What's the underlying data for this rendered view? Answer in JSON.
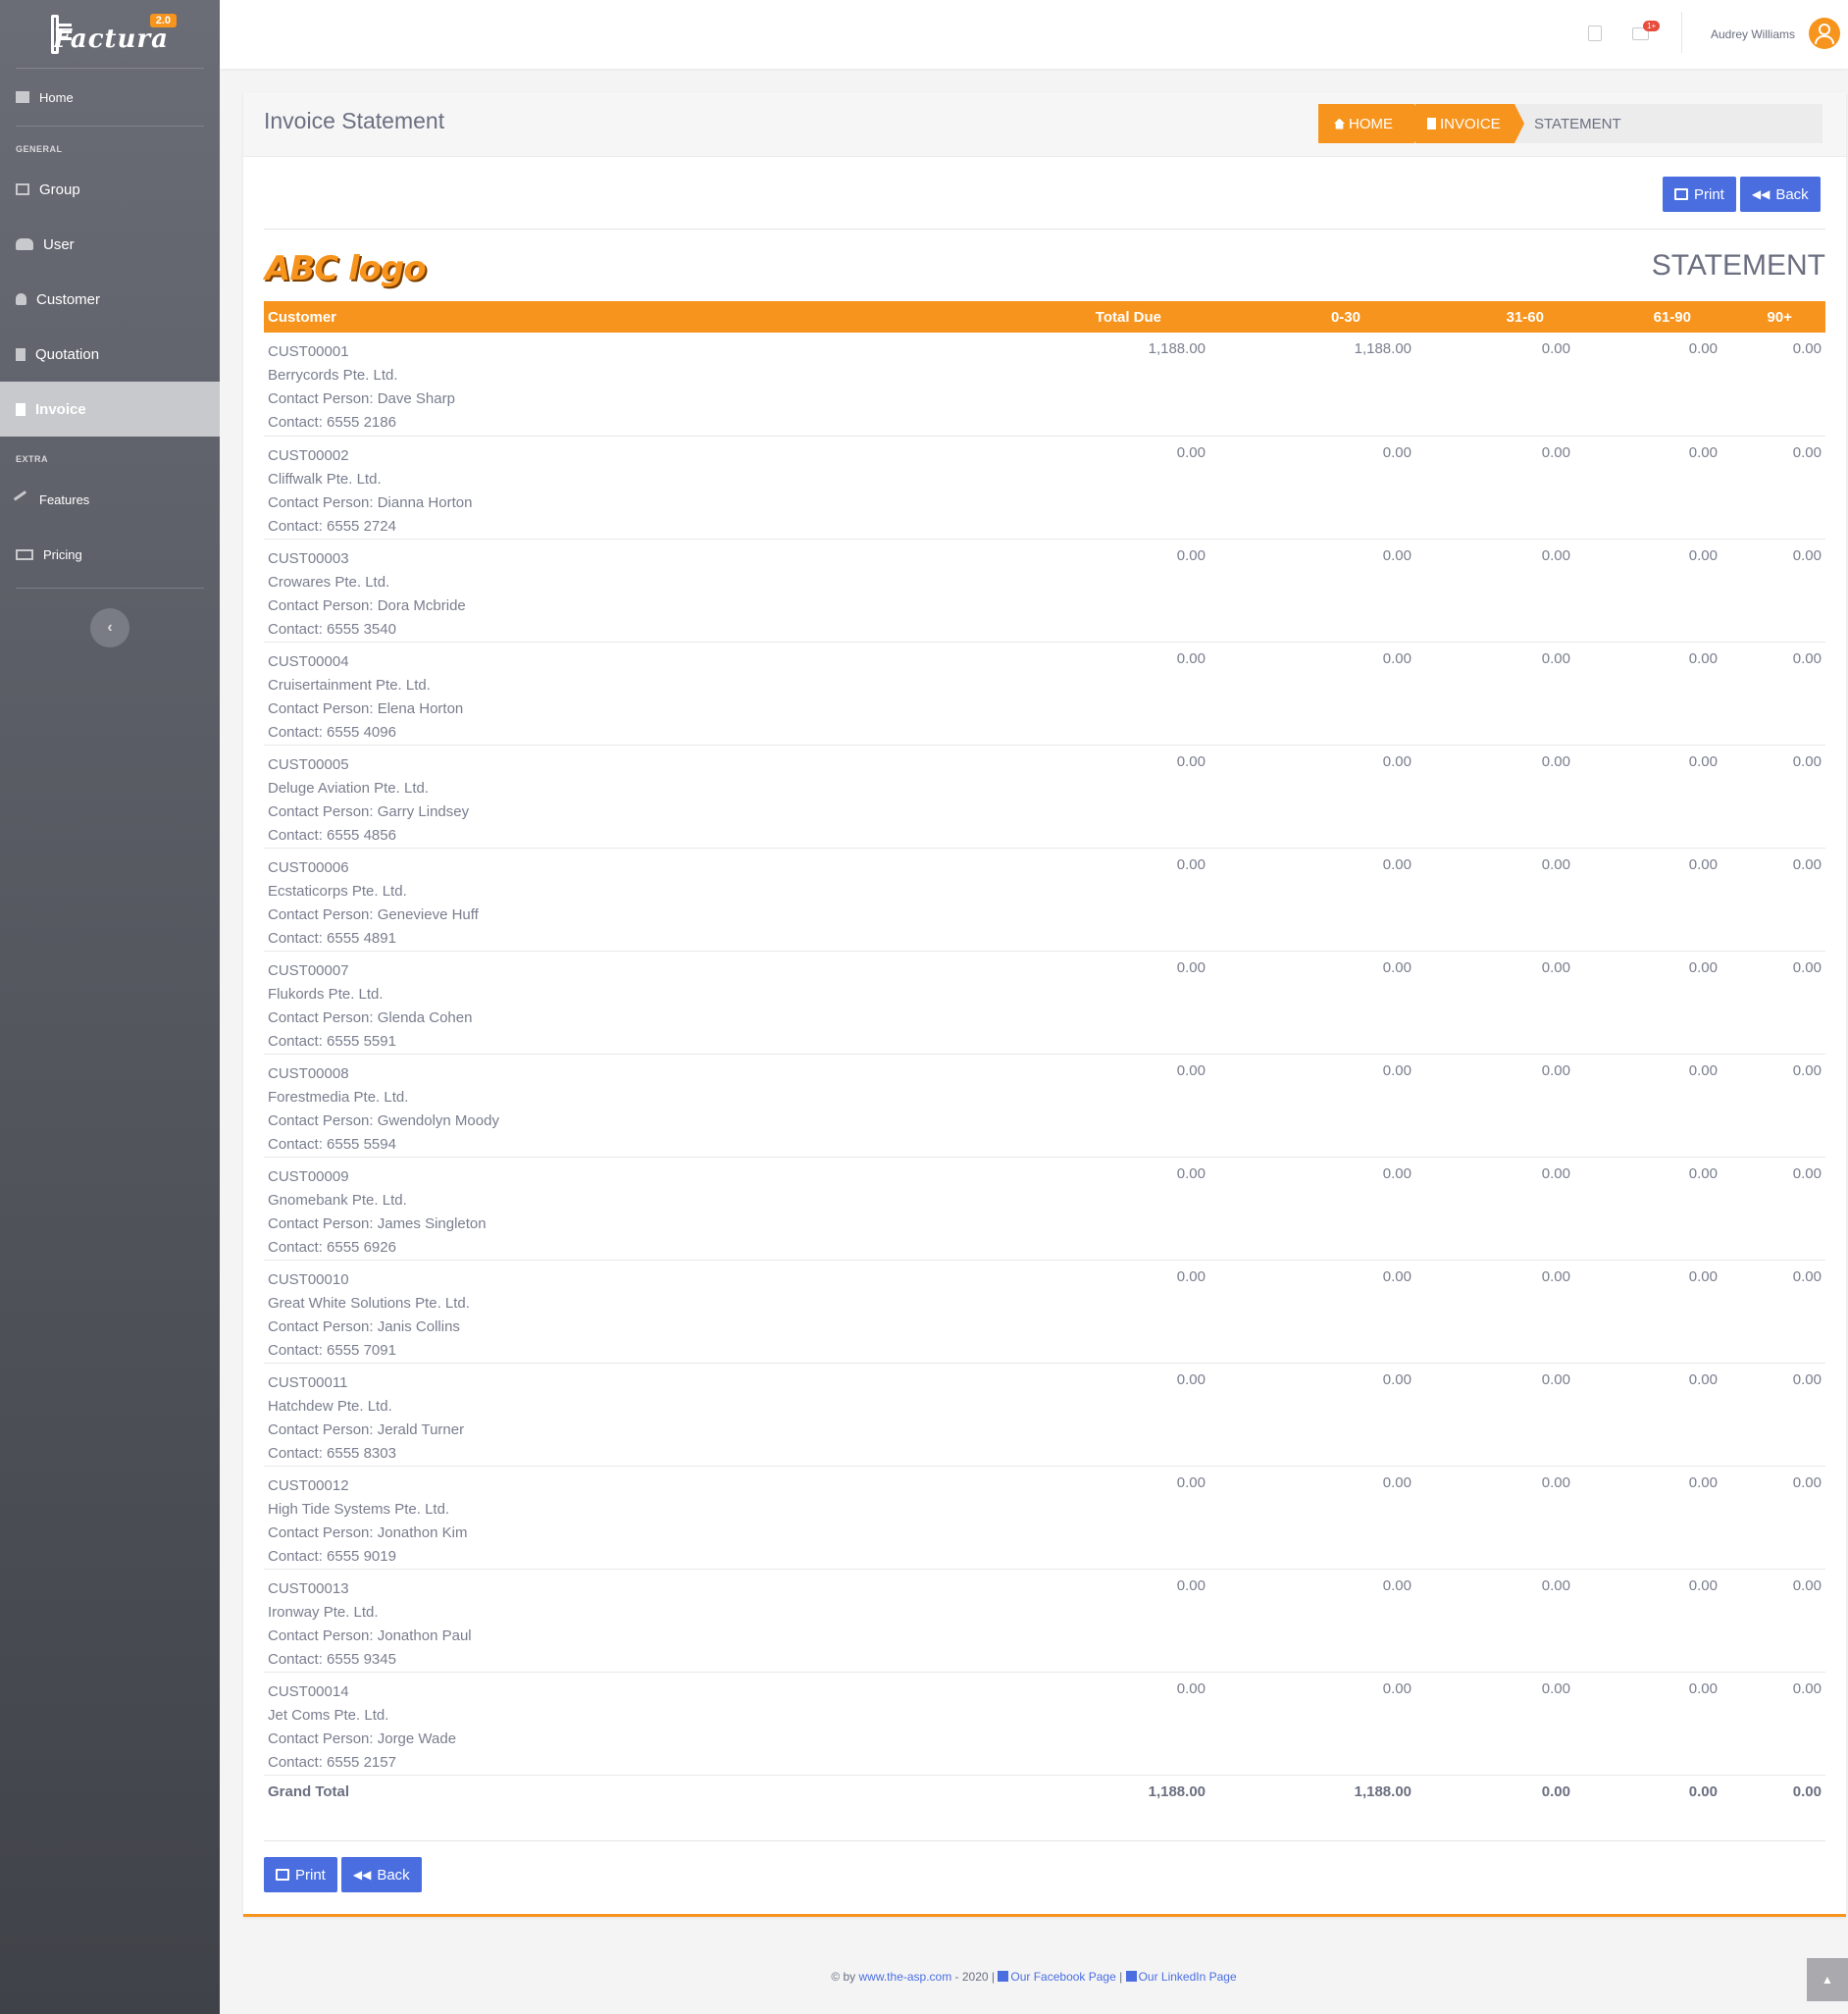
{
  "app": {
    "logo_text": "Factura",
    "version": "2.0"
  },
  "sidebar": {
    "home": "Home",
    "general_label": "GENERAL",
    "general_items": [
      "Group",
      "User",
      "Customer",
      "Quotation",
      "Invoice"
    ],
    "extra_label": "EXTRA",
    "extra_items": [
      "Features",
      "Pricing"
    ]
  },
  "topbar": {
    "user_name": "Audrey Williams",
    "badge": "1+"
  },
  "page": {
    "title": "Invoice Statement",
    "breadcrumb": [
      "HOME",
      "INVOICE",
      "STATEMENT"
    ],
    "print_label": "Print",
    "back_label": "Back",
    "logo_text": "ABC logo",
    "heading": "STATEMENT"
  },
  "table": {
    "headers": [
      "Customer",
      "Total Due",
      "0-30",
      "31-60",
      "61-90",
      "90+"
    ],
    "rows": [
      {
        "code": "CUST00001",
        "company": "Berrycords Pte. Ltd.",
        "person": "Contact Person: Dave Sharp",
        "contact": "Contact: 6555 2186",
        "total": "1,188.00",
        "d30": "1,188.00",
        "d60": "0.00",
        "d90": "0.00",
        "d90p": "0.00"
      },
      {
        "code": "CUST00002",
        "company": "Cliffwalk Pte. Ltd.",
        "person": "Contact Person: Dianna Horton",
        "contact": "Contact: 6555 2724",
        "total": "0.00",
        "d30": "0.00",
        "d60": "0.00",
        "d90": "0.00",
        "d90p": "0.00"
      },
      {
        "code": "CUST00003",
        "company": "Crowares Pte. Ltd.",
        "person": "Contact Person: Dora Mcbride",
        "contact": "Contact: 6555 3540",
        "total": "0.00",
        "d30": "0.00",
        "d60": "0.00",
        "d90": "0.00",
        "d90p": "0.00"
      },
      {
        "code": "CUST00004",
        "company": "Cruisertainment Pte. Ltd.",
        "person": "Contact Person: Elena Horton",
        "contact": "Contact: 6555 4096",
        "total": "0.00",
        "d30": "0.00",
        "d60": "0.00",
        "d90": "0.00",
        "d90p": "0.00"
      },
      {
        "code": "CUST00005",
        "company": "Deluge Aviation Pte. Ltd.",
        "person": "Contact Person: Garry Lindsey",
        "contact": "Contact: 6555 4856",
        "total": "0.00",
        "d30": "0.00",
        "d60": "0.00",
        "d90": "0.00",
        "d90p": "0.00"
      },
      {
        "code": "CUST00006",
        "company": "Ecstaticorps Pte. Ltd.",
        "person": "Contact Person: Genevieve Huff",
        "contact": "Contact: 6555 4891",
        "total": "0.00",
        "d30": "0.00",
        "d60": "0.00",
        "d90": "0.00",
        "d90p": "0.00"
      },
      {
        "code": "CUST00007",
        "company": "Flukords Pte. Ltd.",
        "person": "Contact Person: Glenda Cohen",
        "contact": "Contact: 6555 5591",
        "total": "0.00",
        "d30": "0.00",
        "d60": "0.00",
        "d90": "0.00",
        "d90p": "0.00"
      },
      {
        "code": "CUST00008",
        "company": "Forestmedia Pte. Ltd.",
        "person": "Contact Person: Gwendolyn Moody",
        "contact": "Contact: 6555 5594",
        "total": "0.00",
        "d30": "0.00",
        "d60": "0.00",
        "d90": "0.00",
        "d90p": "0.00"
      },
      {
        "code": "CUST00009",
        "company": "Gnomebank Pte. Ltd.",
        "person": "Contact Person: James Singleton",
        "contact": "Contact: 6555 6926",
        "total": "0.00",
        "d30": "0.00",
        "d60": "0.00",
        "d90": "0.00",
        "d90p": "0.00"
      },
      {
        "code": "CUST00010",
        "company": "Great White Solutions Pte. Ltd.",
        "person": "Contact Person: Janis Collins",
        "contact": "Contact: 6555 7091",
        "total": "0.00",
        "d30": "0.00",
        "d60": "0.00",
        "d90": "0.00",
        "d90p": "0.00"
      },
      {
        "code": "CUST00011",
        "company": "Hatchdew Pte. Ltd.",
        "person": "Contact Person: Jerald Turner",
        "contact": "Contact: 6555 8303",
        "total": "0.00",
        "d30": "0.00",
        "d60": "0.00",
        "d90": "0.00",
        "d90p": "0.00"
      },
      {
        "code": "CUST00012",
        "company": "High Tide Systems Pte. Ltd.",
        "person": "Contact Person: Jonathon Kim",
        "contact": "Contact: 6555 9019",
        "total": "0.00",
        "d30": "0.00",
        "d60": "0.00",
        "d90": "0.00",
        "d90p": "0.00"
      },
      {
        "code": "CUST00013",
        "company": "Ironway Pte. Ltd.",
        "person": "Contact Person: Jonathon Paul",
        "contact": "Contact: 6555 9345",
        "total": "0.00",
        "d30": "0.00",
        "d60": "0.00",
        "d90": "0.00",
        "d90p": "0.00"
      },
      {
        "code": "CUST00014",
        "company": "Jet Coms Pte. Ltd.",
        "person": "Contact Person: Jorge Wade",
        "contact": "Contact: 6555 2157",
        "total": "0.00",
        "d30": "0.00",
        "d60": "0.00",
        "d90": "0.00",
        "d90p": "0.00"
      }
    ],
    "grand_total": {
      "label": "Grand Total",
      "total": "1,188.00",
      "d30": "1,188.00",
      "d60": "0.00",
      "d90": "0.00",
      "d90p": "0.00"
    }
  },
  "footer": {
    "prefix": "© by ",
    "site": "www.the-asp.com",
    "year": " - 2020 | ",
    "facebook": "Our Facebook Page",
    "sep": " | ",
    "linkedin": "Our LinkedIn Page"
  },
  "colors": {
    "accent": "#f7941d",
    "button": "#4a6ee0"
  }
}
